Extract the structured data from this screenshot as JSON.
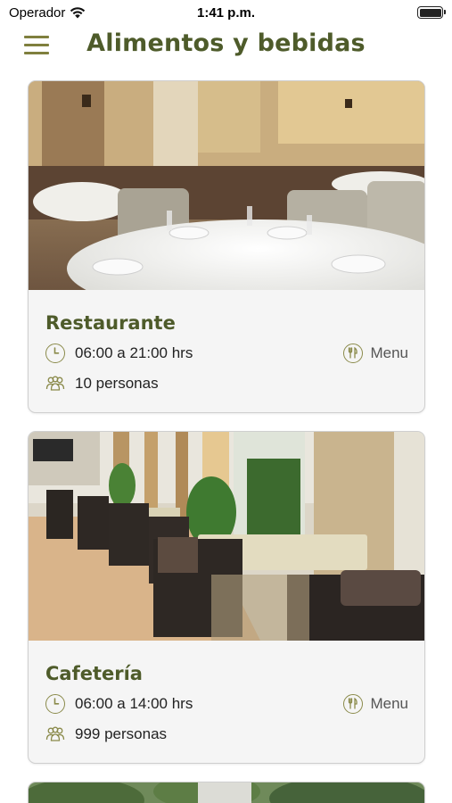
{
  "status_bar": {
    "carrier": "Operador",
    "time": "1:41 p.m.",
    "battery_level": 1.0
  },
  "header": {
    "title": "Alimentos y bebidas",
    "menu_icon": "hamburger-icon"
  },
  "accent_color": "#4e5b2a",
  "icon_color": "#8a8a4a",
  "venues": [
    {
      "name": "Restaurante",
      "hours": "06:00 a 21:00 hrs",
      "capacity": "10 personas",
      "menu_label": "Menu",
      "photo": "restaurant-dining-room"
    },
    {
      "name": "Cafetería",
      "hours": "06:00 a 14:00 hrs",
      "capacity": "999 personas",
      "menu_label": "Menu",
      "photo": "cafeteria-terrace"
    }
  ]
}
